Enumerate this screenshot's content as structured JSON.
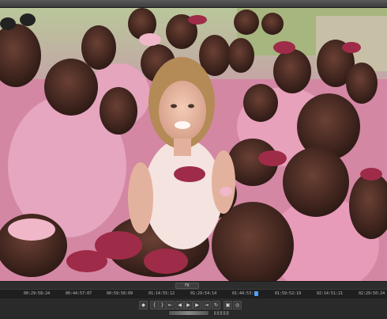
{
  "monitor": {
    "zoom_level": "Fit",
    "timecodes": [
      "00:29:58:24",
      "00:44:57:07",
      "00:59:56:09",
      "01:14:55:12",
      "01:29:54:14",
      "01:44:53:16",
      "01:59:52:19",
      "02:14:51:21",
      "02:29:50:24"
    ]
  },
  "controls": {
    "buttons": [
      {
        "name": "add-marker-button",
        "glyph": "◆"
      },
      {
        "name": "mark-in-button",
        "glyph": "{"
      },
      {
        "name": "mark-out-button",
        "glyph": "}"
      },
      {
        "name": "go-to-in-button",
        "glyph": "⇤"
      },
      {
        "name": "step-back-button",
        "glyph": "◀"
      },
      {
        "name": "play-button",
        "glyph": "▶"
      },
      {
        "name": "step-forward-button",
        "glyph": "▶"
      },
      {
        "name": "go-to-out-button",
        "glyph": "⇥"
      },
      {
        "name": "loop-button",
        "glyph": "↻"
      },
      {
        "name": "safe-margins-button",
        "glyph": "▣"
      },
      {
        "name": "export-frame-button",
        "glyph": "◎"
      }
    ]
  }
}
